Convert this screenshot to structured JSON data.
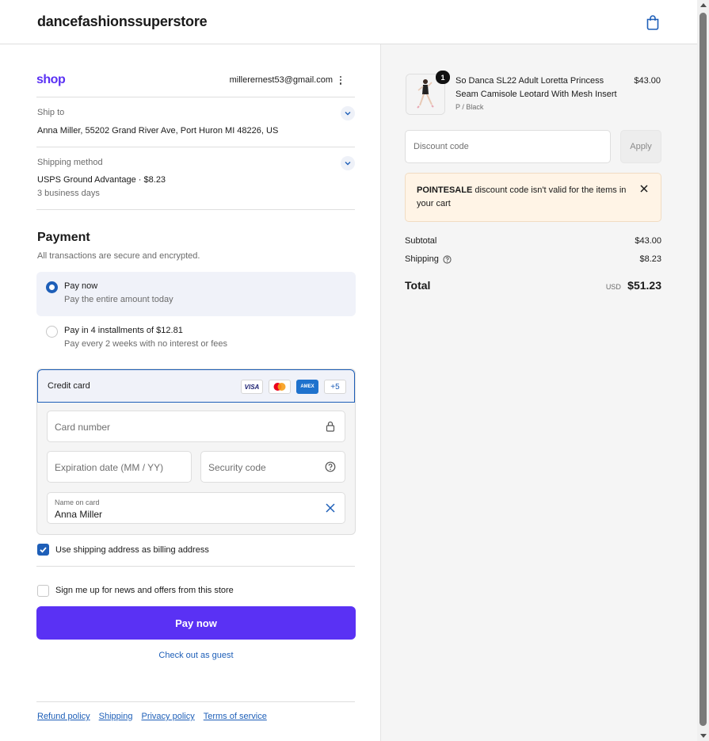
{
  "header": {
    "store_name": "dancefashionssuperstore",
    "cart_icon": "shopping-bag-icon"
  },
  "account": {
    "shop_logo": "shop",
    "email": "millerernest53@gmail.com"
  },
  "ship_to": {
    "label": "Ship to",
    "value": "Anna Miller, 55202 Grand River Ave, Port Huron MI 48226, US"
  },
  "shipping_method": {
    "label": "Shipping method",
    "value": "USPS Ground Advantage · $8.23",
    "sub": "3 business days"
  },
  "payment": {
    "title": "Payment",
    "subtitle": "All transactions are secure and encrypted.",
    "options": [
      {
        "title": "Pay now",
        "sub": "Pay the entire amount today",
        "selected": true
      },
      {
        "title": "Pay in 4 installments of $12.81",
        "sub": "Pay every 2 weeks with no interest or fees",
        "selected": false
      }
    ],
    "credit_card": {
      "title": "Credit card",
      "brands": [
        "VISA",
        "",
        "AMEX",
        "+5"
      ],
      "card_number_placeholder": "Card number",
      "expiration_placeholder": "Expiration date (MM / YY)",
      "security_placeholder": "Security code",
      "name_label": "Name on card",
      "name_value": "Anna Miller"
    },
    "billing_checkbox": {
      "label": "Use shipping address as billing address",
      "checked": true
    },
    "newsletter_checkbox": {
      "label": "Sign me up for news and offers from this store",
      "checked": false
    },
    "pay_button": "Pay now",
    "guest_link": "Check out as guest"
  },
  "footer": {
    "links": [
      "Refund policy",
      "Shipping",
      "Privacy policy",
      "Terms of service"
    ]
  },
  "order": {
    "item": {
      "quantity": "1",
      "name": "So Danca SL22 Adult Loretta Princess Seam Camisole Leotard With Mesh Insert",
      "variant": "P / Black",
      "price": "$43.00"
    },
    "discount": {
      "placeholder": "Discount code",
      "apply": "Apply"
    },
    "warning": {
      "code": "POINTESALE",
      "message": " discount code isn't valid for the items in your cart"
    },
    "subtotal_label": "Subtotal",
    "subtotal": "$43.00",
    "shipping_label": "Shipping",
    "shipping": "$8.23",
    "total_label": "Total",
    "currency": "USD",
    "total": "$51.23"
  },
  "colors": {
    "accent": "#5a31f4",
    "link": "#1e5fb8",
    "warning_bg": "#fff4e6"
  }
}
